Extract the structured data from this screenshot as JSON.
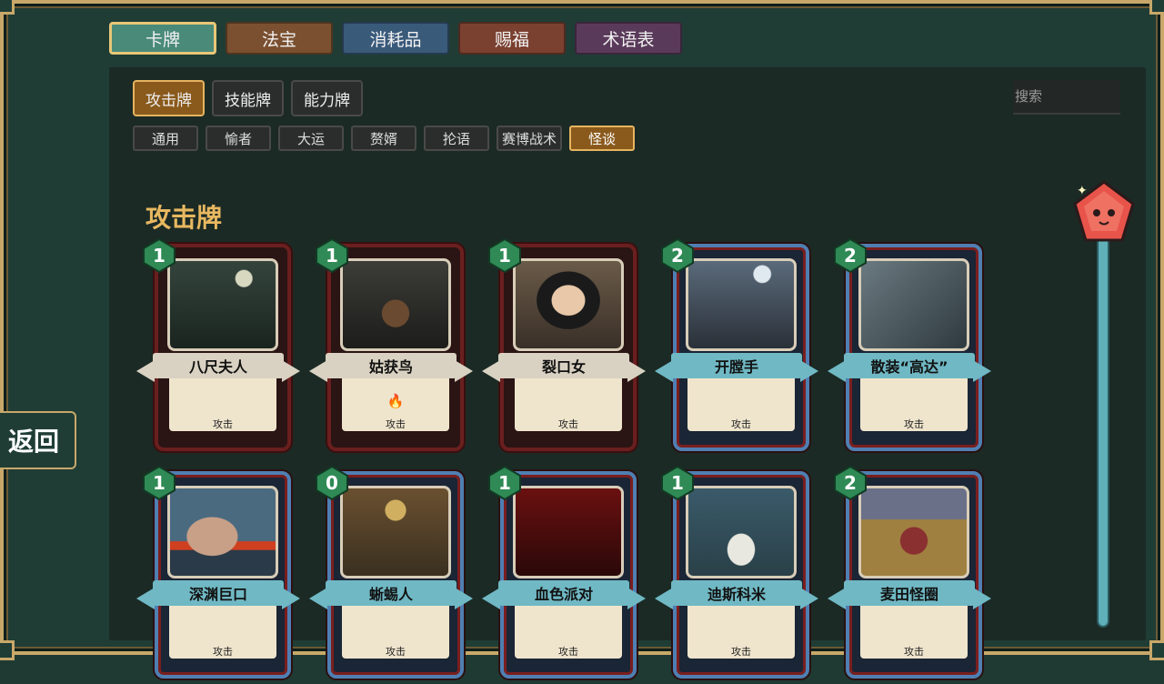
{
  "main_tabs": [
    {
      "label": "卡牌",
      "color": "#4a8a79",
      "active": true
    },
    {
      "label": "法宝",
      "color": "#7a5030"
    },
    {
      "label": "消耗品",
      "color": "#3a5a7a"
    },
    {
      "label": "赐福",
      "color": "#7a4030"
    },
    {
      "label": "术语表",
      "color": "#5a3a5a"
    }
  ],
  "type_tabs": [
    {
      "label": "攻击牌",
      "active": true
    },
    {
      "label": "技能牌"
    },
    {
      "label": "能力牌"
    }
  ],
  "class_tabs": [
    {
      "label": "通用"
    },
    {
      "label": "愉者"
    },
    {
      "label": "大运"
    },
    {
      "label": "赘婿"
    },
    {
      "label": "抡语"
    },
    {
      "label": "赛博战术"
    },
    {
      "label": "怪谈",
      "active": true
    }
  ],
  "search": {
    "placeholder": "搜索"
  },
  "section_title": "攻击牌",
  "back_label": "返回",
  "cards": [
    {
      "name": "八尺夫人",
      "cost": "1",
      "type": "攻击",
      "rarity": "common",
      "art": "lady-in-hat"
    },
    {
      "name": "姑获鸟",
      "cost": "1",
      "type": "攻击",
      "rarity": "common",
      "art": "mother-in-rocking-chair",
      "badge": "fire-icon"
    },
    {
      "name": "裂口女",
      "cost": "1",
      "type": "攻击",
      "rarity": "common",
      "art": "slit-mouth-woman"
    },
    {
      "name": "开膛手",
      "cost": "2",
      "type": "攻击",
      "rarity": "uncommon",
      "art": "man-in-top-hat"
    },
    {
      "name": "散装“高达”",
      "cost": "2",
      "type": "攻击",
      "rarity": "uncommon",
      "art": "broken-robot"
    },
    {
      "name": "深渊巨口",
      "cost": "1",
      "type": "攻击",
      "rarity": "uncommon",
      "art": "woman-open-mouth"
    },
    {
      "name": "蜥蜴人",
      "cost": "0",
      "type": "攻击",
      "rarity": "uncommon",
      "art": "lizard-party"
    },
    {
      "name": "血色派对",
      "cost": "1",
      "type": "攻击",
      "rarity": "uncommon",
      "art": "red-party"
    },
    {
      "name": "迪斯科米",
      "cost": "1",
      "type": "攻击",
      "rarity": "uncommon",
      "art": "rice-field-ghosts"
    },
    {
      "name": "麦田怪圈",
      "cost": "2",
      "type": "攻击",
      "rarity": "uncommon",
      "art": "crop-circle"
    }
  ],
  "colors": {
    "accent": "#e8b860",
    "ribbon_common": "#d9d2c2",
    "ribbon_uncommon": "#6fb8c4",
    "cost_gem": "#2f8a55"
  }
}
